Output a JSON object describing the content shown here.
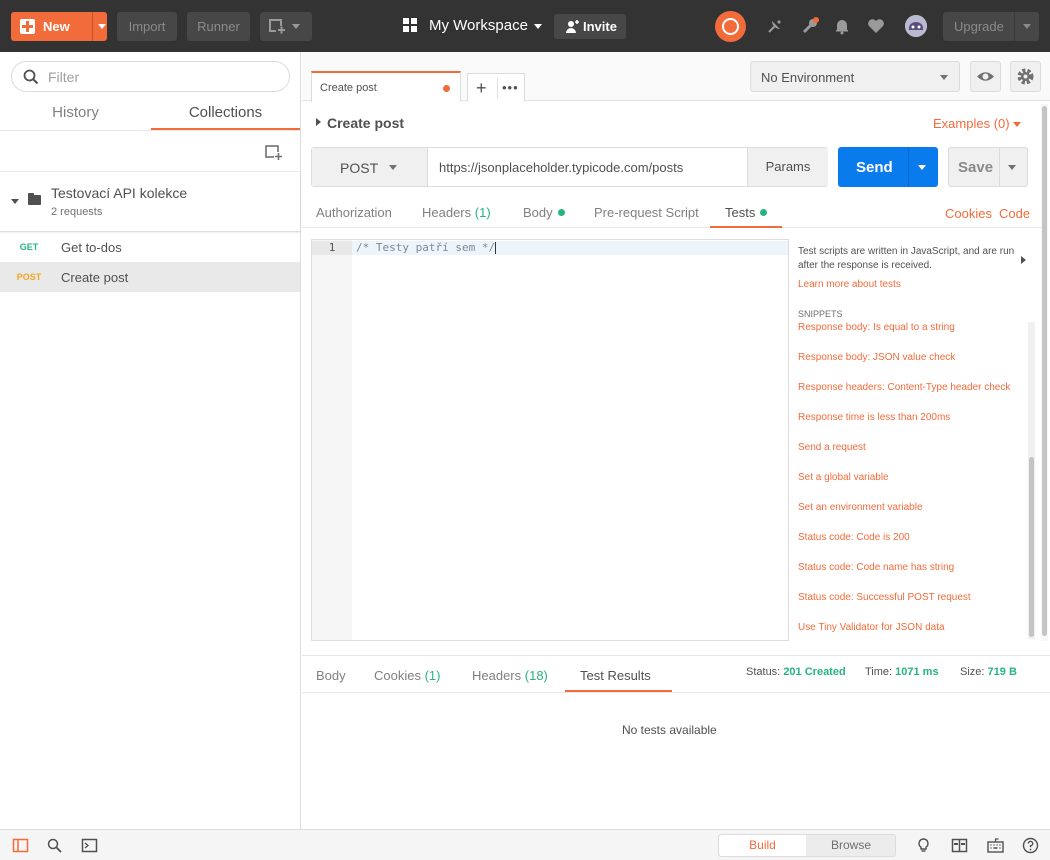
{
  "topbar": {
    "new_label": "New",
    "import_label": "Import",
    "runner_label": "Runner",
    "workspace_label": "My Workspace",
    "invite_label": "Invite",
    "upgrade_label": "Upgrade"
  },
  "sidebar": {
    "filter_placeholder": "Filter",
    "tabs": [
      "History",
      "Collections"
    ],
    "active_tab": "Collections",
    "collection": {
      "name": "Testovací API kolekce",
      "count": "2 requests"
    },
    "requests": [
      {
        "method": "GET",
        "name": "Get to-dos",
        "color": "#26b47f"
      },
      {
        "method": "POST",
        "name": "Create post",
        "color": "#f5a623"
      }
    ]
  },
  "tabs": {
    "active_tab": "Create post"
  },
  "environment": {
    "selected": "No Environment"
  },
  "request": {
    "title": "Create post",
    "examples": "Examples (0)",
    "method": "POST",
    "url": "https://jsonplaceholder.typicode.com/posts",
    "params_label": "Params",
    "send_label": "Send",
    "save_label": "Save",
    "subtabs": {
      "authorization": "Authorization",
      "headers": "Headers",
      "headers_count": "(1)",
      "body": "Body",
      "prerequest": "Pre-request Script",
      "tests": "Tests"
    },
    "cookies_link": "Cookies",
    "code_link": "Code"
  },
  "editor": {
    "line_number": "1",
    "code": "/* Testy patří sem */"
  },
  "help": {
    "description": "Test scripts are written in JavaScript, and are run after the response is received.",
    "learn_more": "Learn more about tests",
    "snippets_heading": "SNIPPETS",
    "snippets": [
      "Response body: Is equal to a string",
      "Response body: JSON value check",
      "Response headers: Content-Type header check",
      "Response time is less than 200ms",
      "Send a request",
      "Set a global variable",
      "Set an environment variable",
      "Status code: Code is 200",
      "Status code: Code name has string",
      "Status code: Successful POST request",
      "Use Tiny Validator for JSON data"
    ]
  },
  "response": {
    "tabs": {
      "body": "Body",
      "cookies": "Cookies",
      "cookies_count": "(1)",
      "headers": "Headers",
      "headers_count": "(18)",
      "test_results": "Test Results"
    },
    "status_label": "Status:",
    "status_value": "201 Created",
    "time_label": "Time:",
    "time_value": "1071 ms",
    "size_label": "Size:",
    "size_value": "719 B",
    "empty_message": "No tests available"
  },
  "statusbar": {
    "build_label": "Build",
    "browse_label": "Browse"
  },
  "colors": {
    "accent": "#f26b3a",
    "send": "#097bed",
    "success": "#26b47f",
    "topbar": "#333333"
  }
}
